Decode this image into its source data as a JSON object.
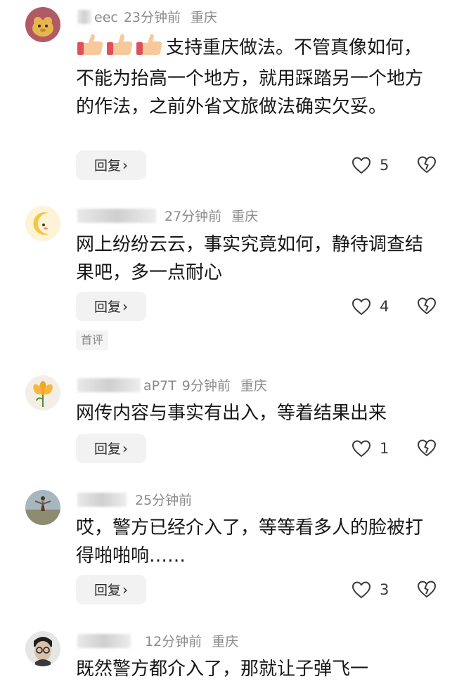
{
  "comments": [
    {
      "username_visible": "eec",
      "time": "23分钟前",
      "location": "重庆",
      "text": "支持重庆做法。不管真像如何，不能为抬高一个地方，就用踩踏另一个地方的作法，之前外省文旅做法确实欠妥。",
      "reply_label": "回复",
      "likes": "5",
      "avatar": "dog-cartoon-avatar",
      "emoji": "thumbs-up x3"
    },
    {
      "username_visible": "",
      "time": "27分钟前",
      "location": "重庆",
      "text": "网上纷纷云云，事实究竟如何，静待调查结果吧，多一点耐心",
      "reply_label": "回复",
      "likes": "4",
      "tag": "首评",
      "avatar": "moon-cartoon-avatar"
    },
    {
      "username_visible": "aP7T",
      "time": "9分钟前",
      "location": "重庆",
      "text": "网传内容与事实有出入，等着结果出来",
      "reply_label": "回复",
      "likes": "1",
      "avatar": "flower-avatar"
    },
    {
      "username_visible": "",
      "time": "25分钟前",
      "location": "",
      "text": "哎，警方已经介入了，等等看多人的脸被打得啪啪响……",
      "reply_label": "回复",
      "likes": "3",
      "avatar": "outdoor-photo-avatar"
    },
    {
      "username_visible": "",
      "time": "12分钟前",
      "location": "重庆",
      "text": "既然警方都介入了，那就让子弹飞一",
      "avatar": "glasses-man-avatar"
    }
  ],
  "colors": {
    "meta": "#8a8a8a",
    "text": "#161616",
    "reply_bg": "#f2f2f2",
    "icon": "#3a3a3a"
  }
}
